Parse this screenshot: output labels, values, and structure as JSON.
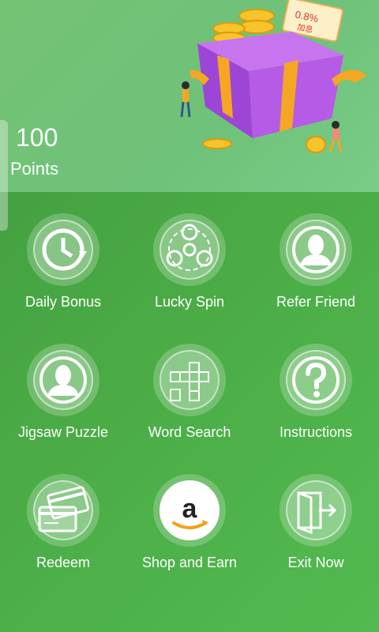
{
  "points": {
    "value": "100",
    "label": "Points"
  },
  "promo_tag": {
    "text": "0.8%",
    "subtext": "加息"
  },
  "menu": [
    {
      "label": "Daily Bonus",
      "icon": "clock-refresh-icon"
    },
    {
      "label": "Lucky Spin",
      "icon": "spinner-icon"
    },
    {
      "label": "Refer Friend",
      "icon": "person-icon"
    },
    {
      "label": "Jigsaw Puzzle",
      "icon": "person-icon"
    },
    {
      "label": "Word Search",
      "icon": "crossword-icon"
    },
    {
      "label": "Instructions",
      "icon": "question-icon"
    },
    {
      "label": "Redeem",
      "icon": "cards-icon"
    },
    {
      "label": "Shop and Earn",
      "icon": "amazon-icon"
    },
    {
      "label": "Exit Now",
      "icon": "exit-door-icon"
    }
  ],
  "colors": {
    "background": "#4aaa45",
    "header": "#74c274",
    "gift_box": "#b65be6",
    "ribbon": "#f5a623",
    "coin": "#f7c52b"
  }
}
